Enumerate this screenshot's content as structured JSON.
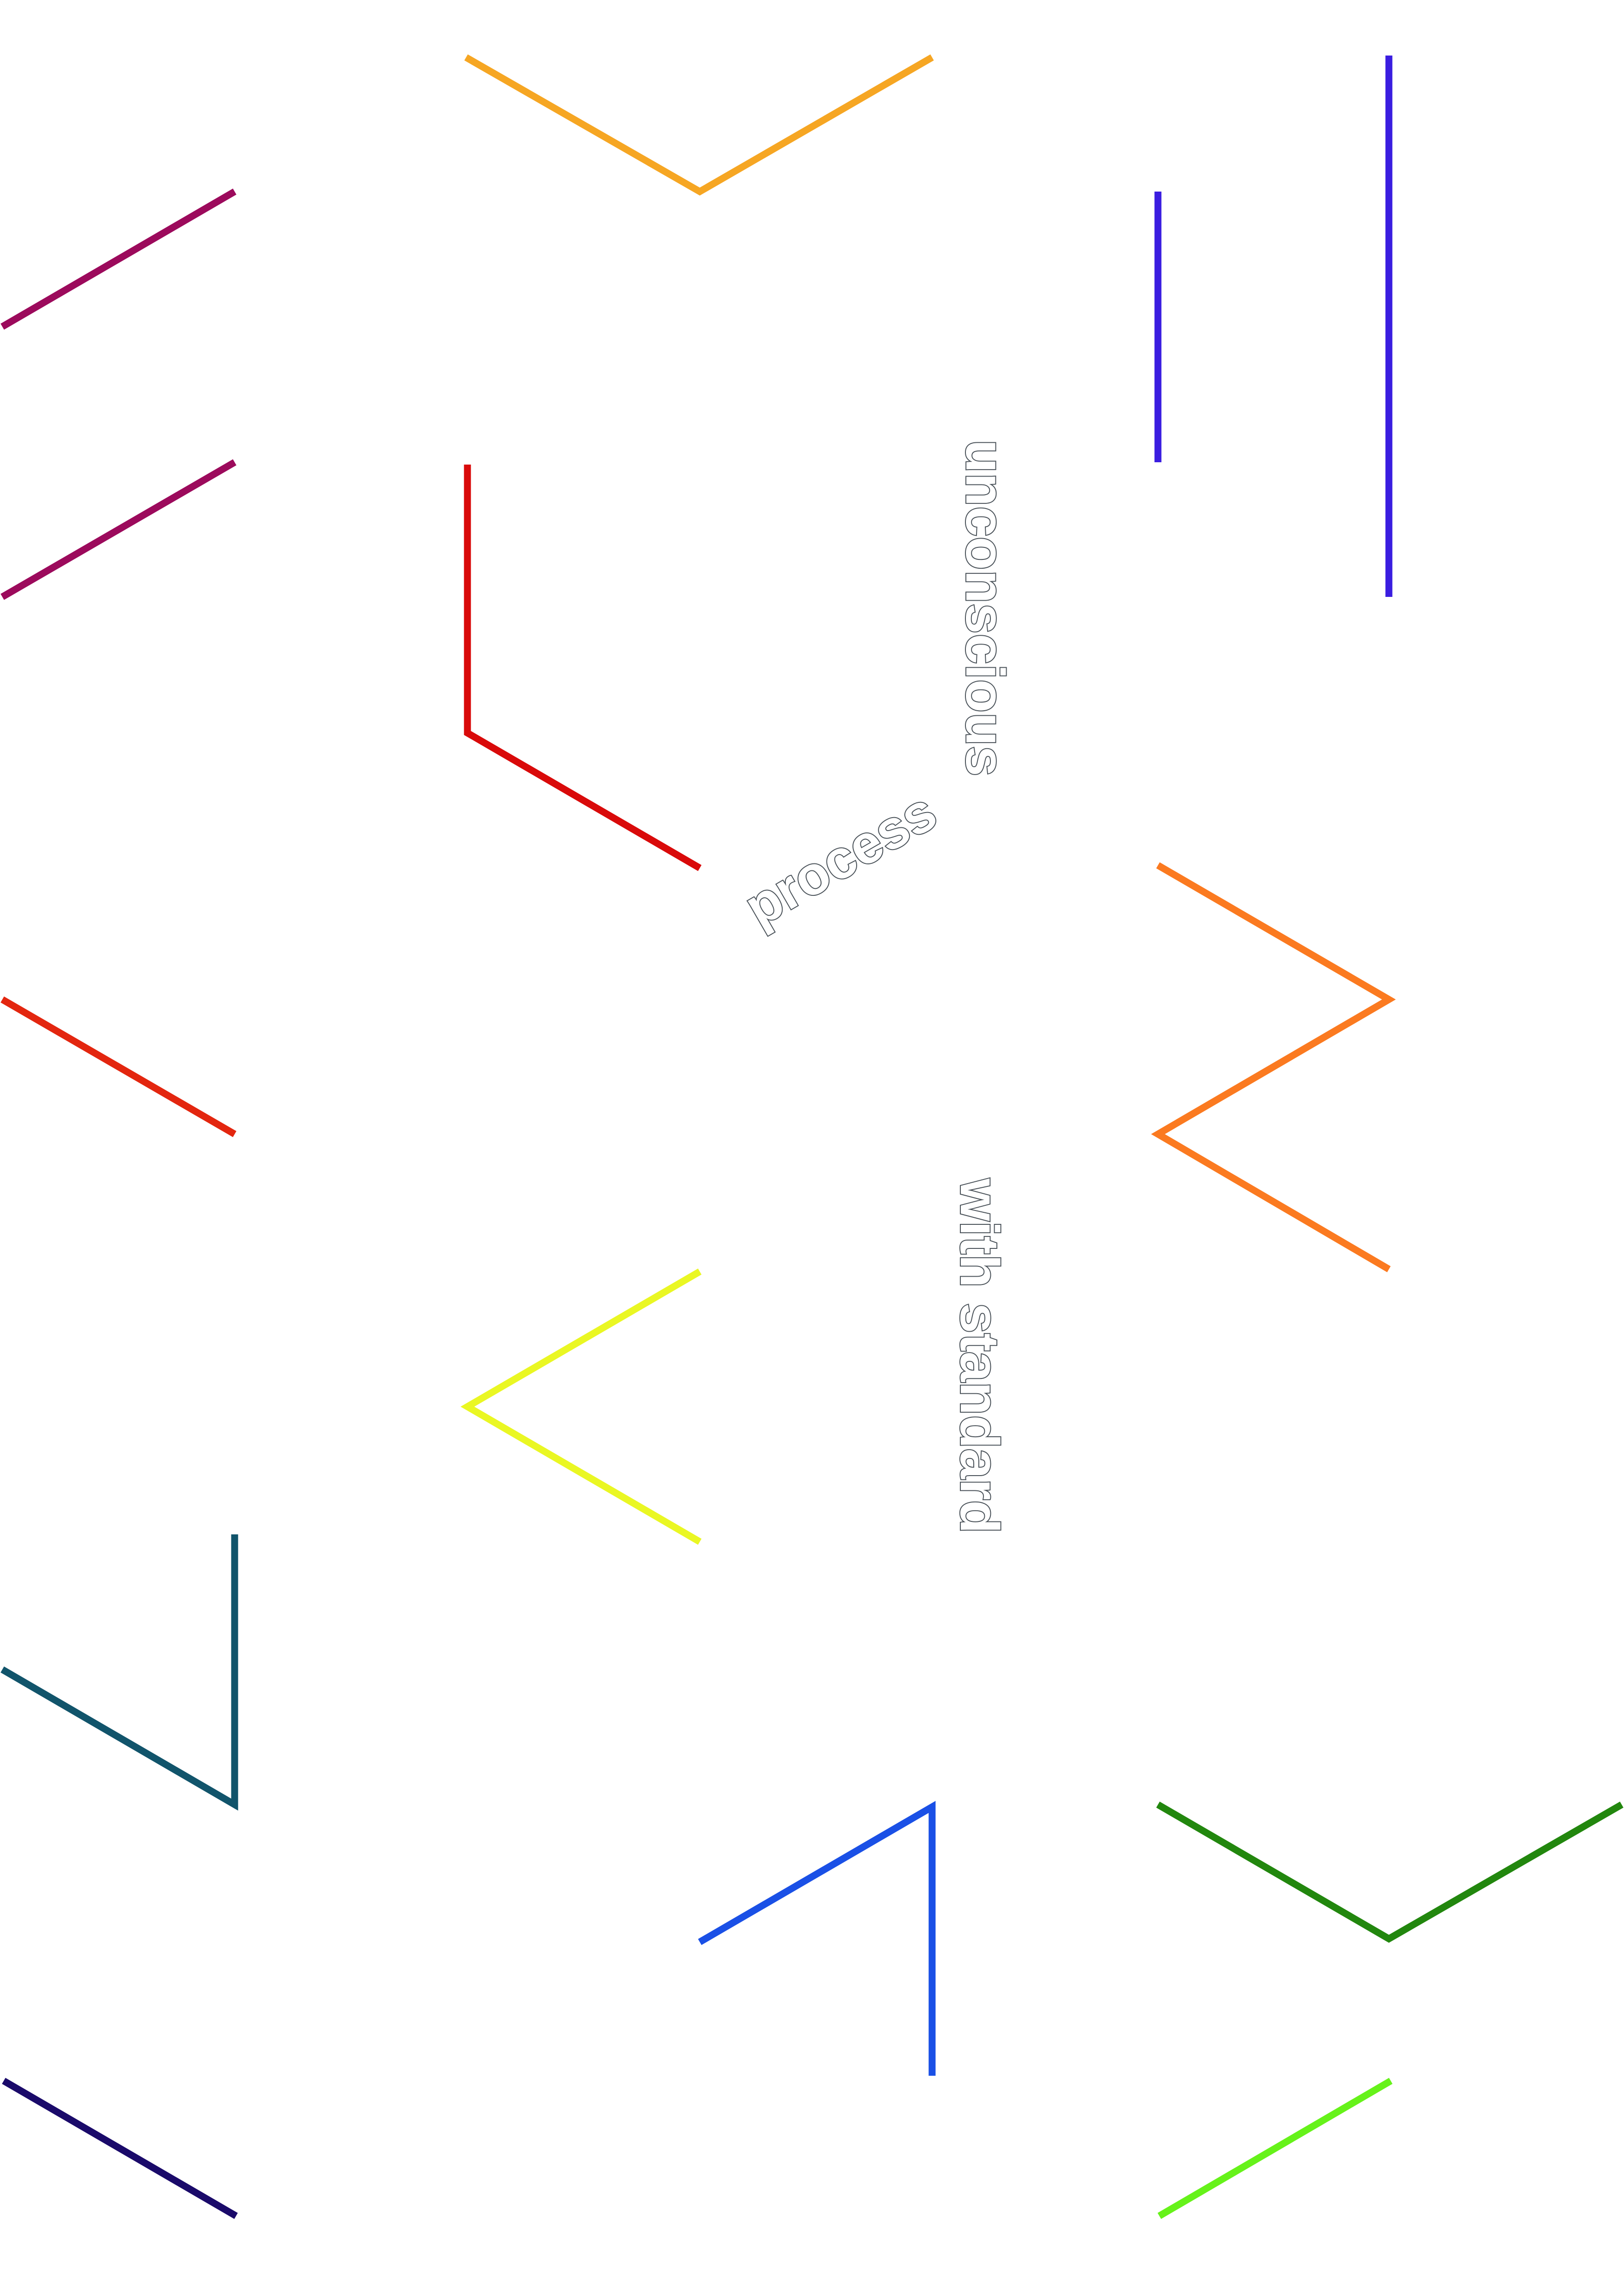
{
  "words": {
    "unconscious": "unconscious",
    "process": "process",
    "with_standard": "with standard"
  },
  "colors": {
    "maroon": "#9c0a5c",
    "amber": "#f6a623",
    "violet_blue": "#3a1de0",
    "red": "#d90a0a",
    "vermilion": "#e3260f",
    "orange": "#fb7a20",
    "yellow": "#eaf723",
    "teal": "#11546b",
    "blue": "#1a50e6",
    "green": "#22870e",
    "navy": "#1a0a6a",
    "lime": "#66f21a",
    "text_outline": "#4a5259"
  },
  "shapes": [
    {
      "name": "maroon-stroke-upper",
      "color": "maroon"
    },
    {
      "name": "maroon-stroke-lower",
      "color": "maroon"
    },
    {
      "name": "amber-chevron",
      "color": "amber"
    },
    {
      "name": "violet-bar-short",
      "color": "violet_blue"
    },
    {
      "name": "violet-bar-tall",
      "color": "violet_blue"
    },
    {
      "name": "red-corner",
      "color": "red"
    },
    {
      "name": "vermilion-stroke",
      "color": "vermilion"
    },
    {
      "name": "orange-zigzag",
      "color": "orange"
    },
    {
      "name": "yellow-chevron",
      "color": "yellow"
    },
    {
      "name": "teal-corner",
      "color": "teal"
    },
    {
      "name": "blue-corner",
      "color": "blue"
    },
    {
      "name": "green-chevron",
      "color": "green"
    },
    {
      "name": "navy-stroke",
      "color": "navy"
    },
    {
      "name": "lime-stroke",
      "color": "lime"
    }
  ]
}
